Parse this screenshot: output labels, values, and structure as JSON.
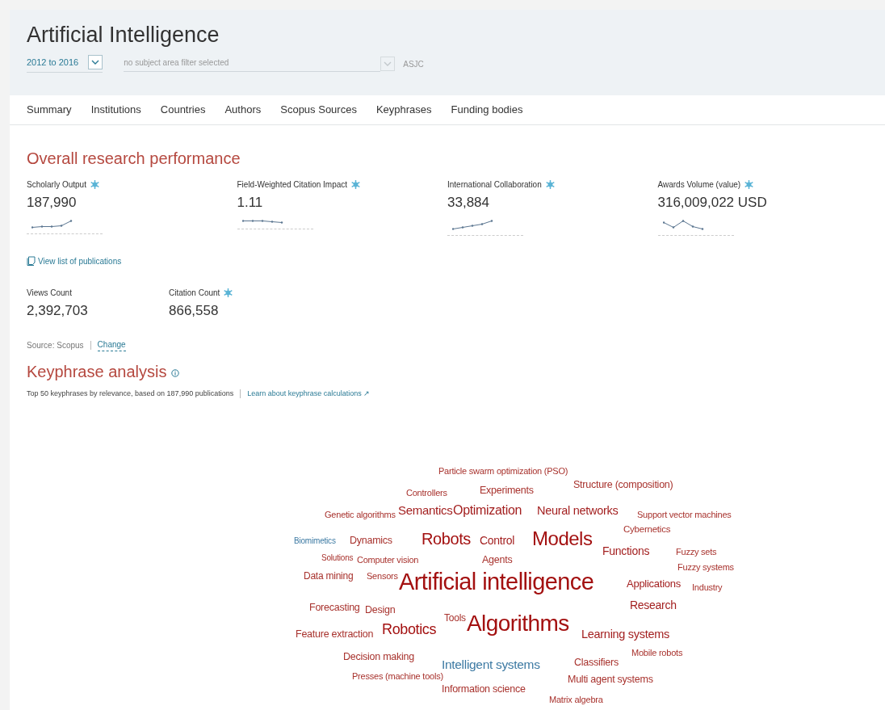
{
  "header": {
    "title": "Artificial Intelligence",
    "year_range": "2012 to 2016",
    "subject_filter": {
      "placeholder": "no subject area filter selected"
    },
    "classification": "ASJC"
  },
  "tabs": [
    {
      "label": "Summary"
    },
    {
      "label": "Institutions"
    },
    {
      "label": "Countries"
    },
    {
      "label": "Authors"
    },
    {
      "label": "Scopus Sources"
    },
    {
      "label": "Keyphrases"
    },
    {
      "label": "Funding bodies"
    }
  ],
  "performance": {
    "title": "Overall research performance",
    "metrics": [
      {
        "label": "Scholarly Output",
        "value": "187,990"
      },
      {
        "label": "Field-Weighted Citation Impact",
        "value": "1.11"
      },
      {
        "label": "International Collaboration",
        "value": "33,884"
      },
      {
        "label": "Awards Volume (value)",
        "value": "316,009,022 USD"
      }
    ],
    "publications_link": "View list of publications",
    "counts": [
      {
        "label": "Views Count",
        "value": "2,392,703",
        "scival": false
      },
      {
        "label": "Citation Count",
        "value": "866,558",
        "scival": true
      }
    ],
    "source": "Source: Scopus",
    "change_link": "Change"
  },
  "keyphrases": {
    "title": "Keyphrase analysis",
    "summary": "Top 50 keyphrases by relevance, based on 187,990 publications",
    "learn_link": "Learn about keyphrase calculations ↗",
    "words": [
      {
        "text": "Particle swarm optimization (PSO)",
        "color": "#a8322d"
      },
      {
        "text": "Structure (composition)",
        "color": "#a8322d"
      },
      {
        "text": "Controllers",
        "color": "#a8322d"
      },
      {
        "text": "Experiments",
        "color": "#a8322d"
      },
      {
        "text": "Genetic algorithms",
        "color": "#a8322d"
      },
      {
        "text": "Semantics",
        "color": "#a31f1f"
      },
      {
        "text": "Optimization",
        "color": "#a31f1f"
      },
      {
        "text": "Neural networks",
        "color": "#a31f1f"
      },
      {
        "text": "Support vector machines",
        "color": "#a8322d"
      },
      {
        "text": "Cybernetics",
        "color": "#a8322d"
      },
      {
        "text": "Biomimetics",
        "color": "#3d7aa3"
      },
      {
        "text": "Dynamics",
        "color": "#a8322d"
      },
      {
        "text": "Robots",
        "color": "#a31010"
      },
      {
        "text": "Control",
        "color": "#a31f1f"
      },
      {
        "text": "Models",
        "color": "#a31010"
      },
      {
        "text": "Functions",
        "color": "#a31f1f"
      },
      {
        "text": "Fuzzy sets",
        "color": "#a8322d"
      },
      {
        "text": "Solutions",
        "color": "#a8322d"
      },
      {
        "text": "Computer vision",
        "color": "#a8322d"
      },
      {
        "text": "Agents",
        "color": "#a8322d"
      },
      {
        "text": "Fuzzy systems",
        "color": "#a8322d"
      },
      {
        "text": "Data mining",
        "color": "#a8322d"
      },
      {
        "text": "Sensors",
        "color": "#a8322d"
      },
      {
        "text": "Artificial intelligence",
        "color": "#a31010"
      },
      {
        "text": "Applications",
        "color": "#a31f1f"
      },
      {
        "text": "Industry",
        "color": "#a8322d"
      },
      {
        "text": "Forecasting",
        "color": "#a8322d"
      },
      {
        "text": "Design",
        "color": "#a8322d"
      },
      {
        "text": "Research",
        "color": "#a31f1f"
      },
      {
        "text": "Feature extraction",
        "color": "#a8322d"
      },
      {
        "text": "Robotics",
        "color": "#a31010"
      },
      {
        "text": "Tools",
        "color": "#a8322d"
      },
      {
        "text": "Algorithms",
        "color": "#a31010"
      },
      {
        "text": "Learning systems",
        "color": "#a31f1f"
      },
      {
        "text": "Mobile robots",
        "color": "#a8322d"
      },
      {
        "text": "Decision making",
        "color": "#a8322d"
      },
      {
        "text": "Intelligent systems",
        "color": "#3d7aa3"
      },
      {
        "text": "Classifiers",
        "color": "#a8322d"
      },
      {
        "text": "Presses (machine tools)",
        "color": "#a8322d"
      },
      {
        "text": "Multi agent systems",
        "color": "#a8322d"
      },
      {
        "text": "Information science",
        "color": "#a8322d"
      },
      {
        "text": "Matrix algebra",
        "color": "#a8322d"
      }
    ]
  }
}
